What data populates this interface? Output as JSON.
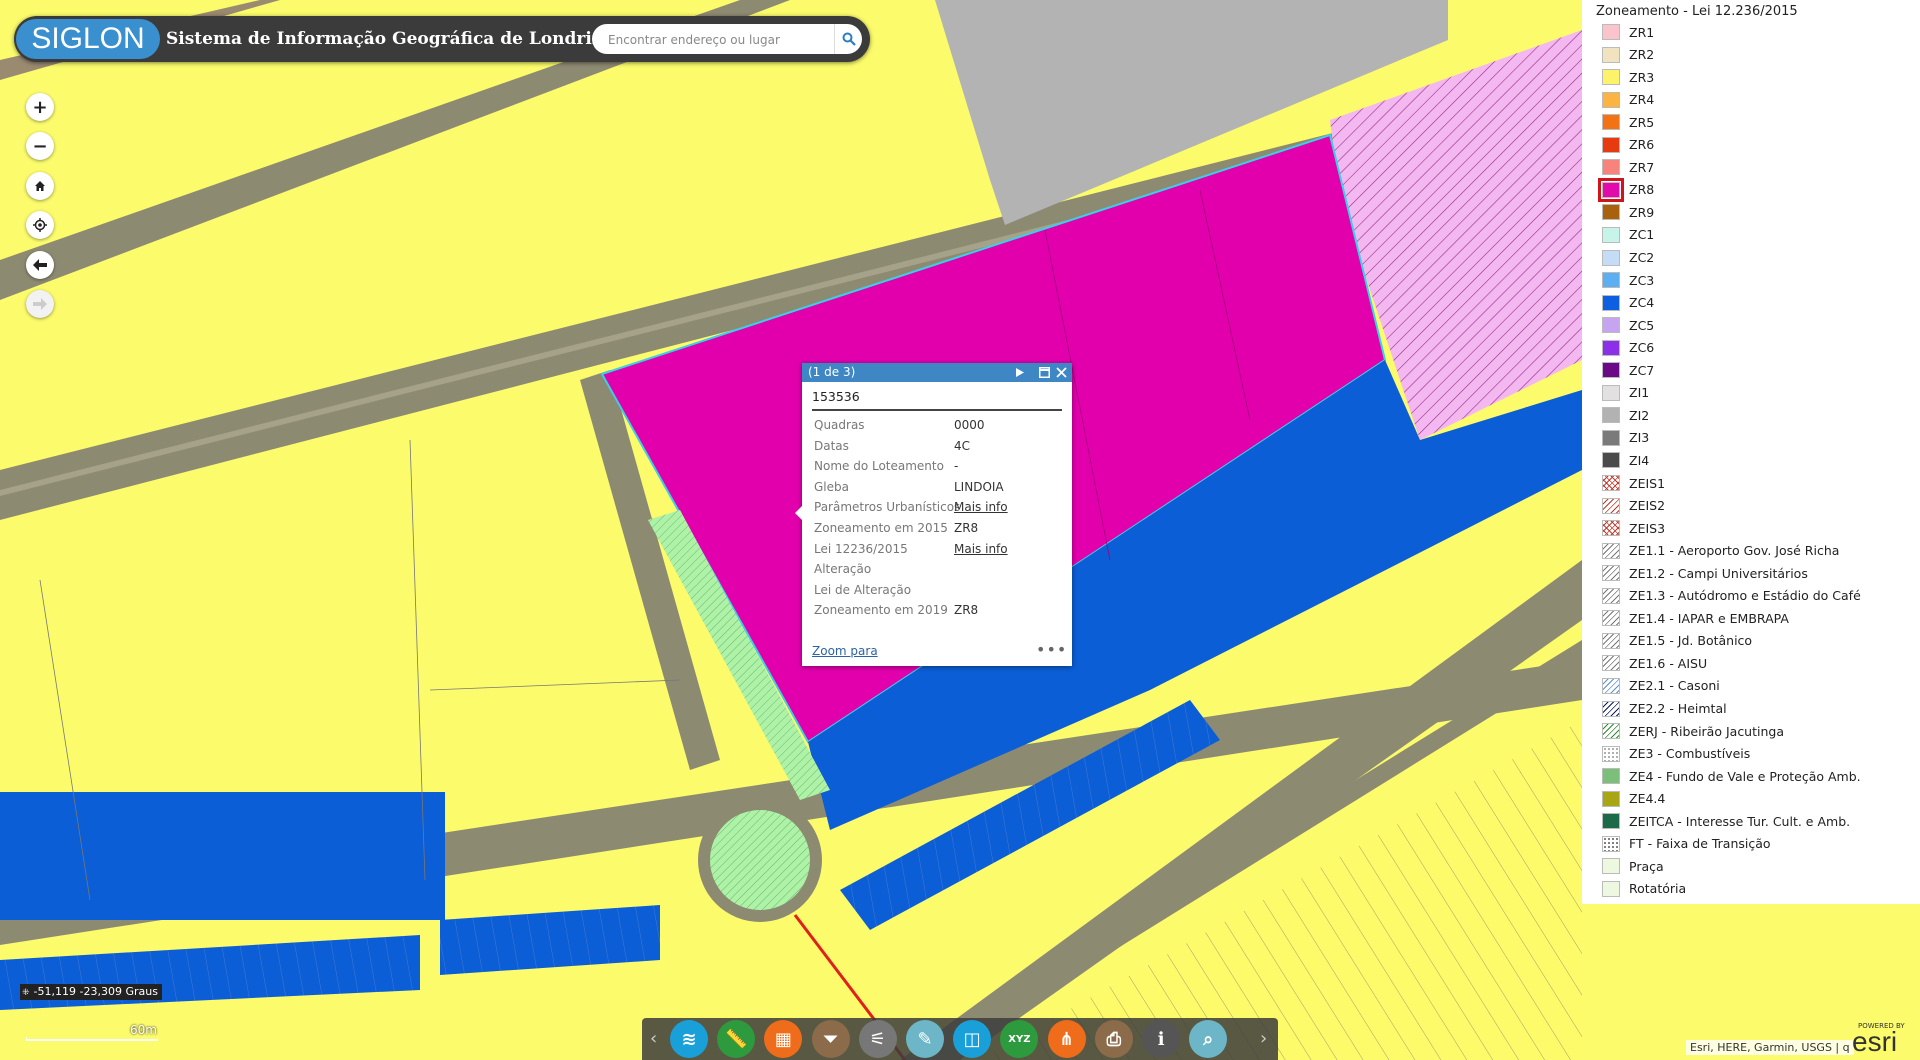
{
  "header": {
    "logo_text": "SIGLON",
    "app_title": "Sistema de Informação Geográfica de Londrina",
    "search_placeholder": "Encontrar endereço ou lugar"
  },
  "map_controls": [
    "zoom-in",
    "zoom-out",
    "home",
    "locate",
    "previous-extent",
    "next-extent"
  ],
  "popup": {
    "counter": "(1 de 3)",
    "feature_id": "153536",
    "fields": [
      {
        "label": "Quadras",
        "value": "0000",
        "link": false
      },
      {
        "label": "Datas",
        "value": "4C",
        "link": false
      },
      {
        "label": "Nome do Loteamento",
        "value": "-",
        "link": false
      },
      {
        "label": "Gleba",
        "value": "LINDOIA",
        "link": false
      },
      {
        "label": "Parâmetros Urbanísticos",
        "value": "Mais info",
        "link": true
      },
      {
        "label": "Zoneamento em 2015",
        "value": "ZR8",
        "link": false
      },
      {
        "label": "Lei 12236/2015",
        "value": "Mais info",
        "link": true
      },
      {
        "label": "Alteração",
        "value": "",
        "link": false
      },
      {
        "label": "Lei de Alteração",
        "value": "",
        "link": false
      },
      {
        "label": "Zoneamento em 2019",
        "value": "ZR8",
        "link": false
      }
    ],
    "zoom_link": "Zoom para",
    "more": "•••"
  },
  "legend": {
    "title": "Zoneamento - Lei 12.236/2015",
    "selected": "ZR8",
    "items": [
      {
        "label": "ZR1",
        "color": "#f9c4cc",
        "pattern": "solid"
      },
      {
        "label": "ZR2",
        "color": "#f2e3c0",
        "pattern": "solid"
      },
      {
        "label": "ZR3",
        "color": "#fdf36a",
        "pattern": "solid"
      },
      {
        "label": "ZR4",
        "color": "#fbb441",
        "pattern": "solid"
      },
      {
        "label": "ZR5",
        "color": "#f47216",
        "pattern": "solid"
      },
      {
        "label": "ZR6",
        "color": "#e83a10",
        "pattern": "solid"
      },
      {
        "label": "ZR7",
        "color": "#f6847c",
        "pattern": "solid"
      },
      {
        "label": "ZR8",
        "color": "#e20aaa",
        "pattern": "solid"
      },
      {
        "label": "ZR9",
        "color": "#a8620e",
        "pattern": "solid"
      },
      {
        "label": "ZC1",
        "color": "#c6f4e8",
        "pattern": "solid"
      },
      {
        "label": "ZC2",
        "color": "#c4dcf6",
        "pattern": "solid"
      },
      {
        "label": "ZC3",
        "color": "#5cb0f2",
        "pattern": "solid"
      },
      {
        "label": "ZC4",
        "color": "#0d5ee0",
        "pattern": "solid"
      },
      {
        "label": "ZC5",
        "color": "#c6a4f0",
        "pattern": "solid"
      },
      {
        "label": "ZC6",
        "color": "#8a30e8",
        "pattern": "solid"
      },
      {
        "label": "ZC7",
        "color": "#6a0a86",
        "pattern": "solid"
      },
      {
        "label": "ZI1",
        "color": "#e2e0e0",
        "pattern": "solid"
      },
      {
        "label": "ZI2",
        "color": "#b2b2b2",
        "pattern": "solid"
      },
      {
        "label": "ZI3",
        "color": "#7a7a7a",
        "pattern": "solid"
      },
      {
        "label": "ZI4",
        "color": "#4a4a4a",
        "pattern": "solid"
      },
      {
        "label": "ZEIS1",
        "color": "#c0392b",
        "pattern": "hatch-x"
      },
      {
        "label": "ZEIS2",
        "color": "#c0392b",
        "pattern": "hatch"
      },
      {
        "label": "ZEIS3",
        "color": "#c0392b",
        "pattern": "hatch-x"
      },
      {
        "label": "ZE1.1 - Aeroporto Gov. José Richa",
        "color": "#777777",
        "pattern": "hatch"
      },
      {
        "label": "ZE1.2 - Campi Universitários",
        "color": "#777777",
        "pattern": "hatch"
      },
      {
        "label": "ZE1.3 - Autódromo e Estádio do Café",
        "color": "#777777",
        "pattern": "hatch"
      },
      {
        "label": "ZE1.4 - IAPAR e EMBRAPA",
        "color": "#777777",
        "pattern": "hatch"
      },
      {
        "label": "ZE1.5 - Jd. Botânico",
        "color": "#777777",
        "pattern": "hatch"
      },
      {
        "label": "ZE1.6 - AISU",
        "color": "#777777",
        "pattern": "hatch"
      },
      {
        "label": "ZE2.1 - Casoni",
        "color": "#5b8fd6",
        "pattern": "hatch"
      },
      {
        "label": "ZE2.2 - Heimtal",
        "color": "#0a1a5e",
        "pattern": "hatch"
      },
      {
        "label": "ZERJ - Ribeirão Jacutinga",
        "color": "#2a8a2a",
        "pattern": "hatch"
      },
      {
        "label": "ZE3 - Combustíveis",
        "color": "#aaaaaa",
        "pattern": "dots"
      },
      {
        "label": "ZE4 - Fundo de Vale e Proteção Amb.",
        "color": "#7cbf7a",
        "pattern": "solid"
      },
      {
        "label": "ZE4.4",
        "color": "#a8a614",
        "pattern": "solid"
      },
      {
        "label": "ZEITCA - Interesse Tur. Cult. e Amb.",
        "color": "#1d6a48",
        "pattern": "solid"
      },
      {
        "label": "FT - Faixa de Transição",
        "color": "#777777",
        "pattern": "dots"
      },
      {
        "label": "Praça",
        "color": "#eef8e0",
        "pattern": "solid"
      },
      {
        "label": "Rotatória",
        "color": "#eef8e0",
        "pattern": "solid"
      }
    ]
  },
  "toolbar": {
    "tools": [
      {
        "name": "layers",
        "color": "#1aa0d8"
      },
      {
        "name": "measure",
        "color": "#2e9a3e"
      },
      {
        "name": "basemap-gallery",
        "color": "#ef6c1a"
      },
      {
        "name": "filter",
        "color": "#8b6b4a"
      },
      {
        "name": "attribute-filter",
        "color": "#777777"
      },
      {
        "name": "draw",
        "color": "#6cb6c8"
      },
      {
        "name": "swipe",
        "color": "#1aa0d8"
      },
      {
        "name": "coordinates-xyz",
        "color": "#2e9a3e"
      },
      {
        "name": "share",
        "color": "#ef6c1a"
      },
      {
        "name": "print",
        "color": "#8b6b4a"
      },
      {
        "name": "info",
        "color": "#555555"
      },
      {
        "name": "search-features",
        "color": "#6cb6c8"
      }
    ],
    "xyz_label": "XYZ"
  },
  "coordinates": "-51,119 -23,309 Graus",
  "scale_label": "60m",
  "attribution": "Esri, HERE, Garmin, USGS | q",
  "esri": {
    "powered_by": "POWERED BY",
    "brand": "esri"
  }
}
